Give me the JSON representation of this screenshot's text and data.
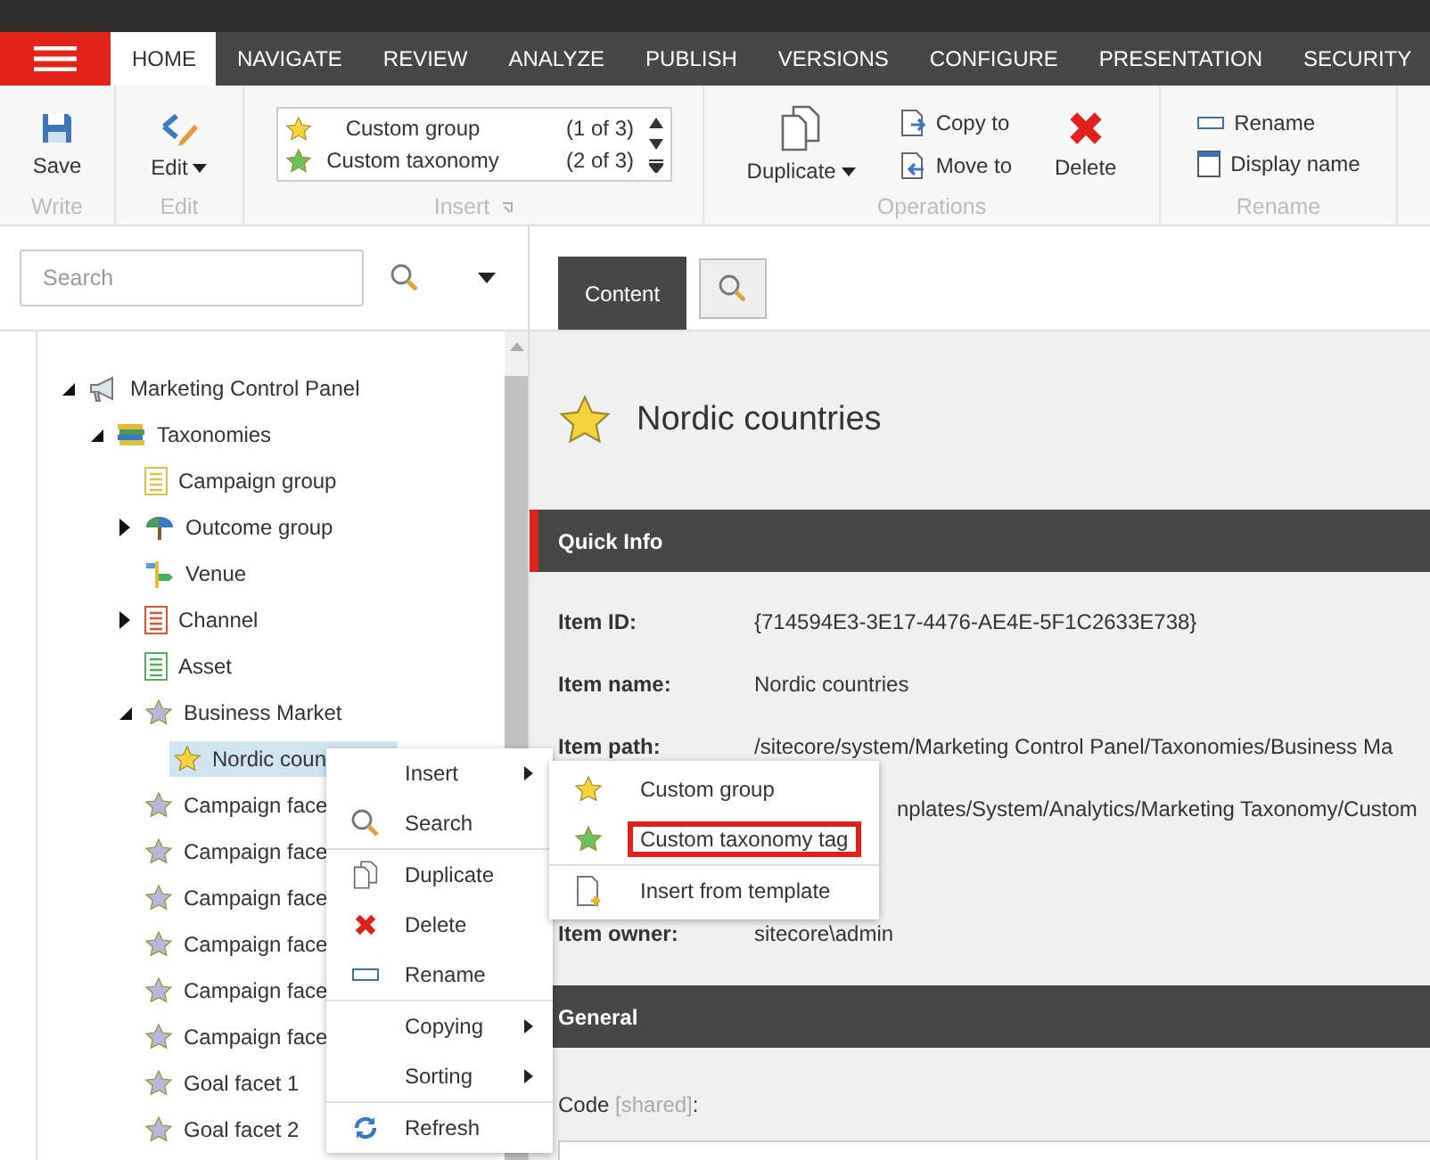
{
  "ribbon": {
    "tabs": [
      {
        "label": "HOME",
        "selected": true
      },
      {
        "label": "NAVIGATE",
        "selected": false
      },
      {
        "label": "REVIEW",
        "selected": false
      },
      {
        "label": "ANALYZE",
        "selected": false
      },
      {
        "label": "PUBLISH",
        "selected": false
      },
      {
        "label": "VERSIONS",
        "selected": false
      },
      {
        "label": "CONFIGURE",
        "selected": false
      },
      {
        "label": "PRESENTATION",
        "selected": false
      },
      {
        "label": "SECURITY",
        "selected": false
      }
    ],
    "write": {
      "label": "Write",
      "save": "Save"
    },
    "edit": {
      "label": "Edit",
      "button": "Edit"
    },
    "insert": {
      "label": "Insert",
      "items": [
        {
          "label": "Custom group",
          "count": "(1 of 3)"
        },
        {
          "label": "Custom taxonomy",
          "count": "(2 of 3)"
        }
      ]
    },
    "operations": {
      "label": "Operations",
      "duplicate": "Duplicate",
      "copy_to": "Copy to",
      "move_to": "Move to",
      "delete": "Delete"
    },
    "rename": {
      "label": "Rename",
      "rename": "Rename",
      "display_name": "Display name"
    }
  },
  "search": {
    "placeholder": "Search"
  },
  "tree": {
    "items": [
      {
        "label": "Marketing Control Panel",
        "kind": "root",
        "expanded": true,
        "selected": false,
        "children": [
          {
            "label": "Taxonomies",
            "kind": "books",
            "expanded": true,
            "selected": false,
            "children": [
              {
                "label": "Campaign group",
                "kind": "list",
                "color": "#d9c24a",
                "selected": false
              },
              {
                "label": "Outcome group",
                "kind": "umbrella",
                "expanded": false,
                "selected": false
              },
              {
                "label": "Venue",
                "kind": "sign",
                "selected": false
              },
              {
                "label": "Channel",
                "kind": "list",
                "color": "#d2553a",
                "expanded": false,
                "selected": false
              },
              {
                "label": "Asset",
                "kind": "list",
                "color": "#5aa85a",
                "selected": false
              },
              {
                "label": "Business Market",
                "kind": "star",
                "expanded": true,
                "selected": false,
                "children": [
                  {
                    "label": "Nordic coun",
                    "kind": "star",
                    "selected": true
                  }
                ]
              },
              {
                "label": "Campaign face",
                "kind": "star",
                "selected": false
              },
              {
                "label": "Campaign face",
                "kind": "star",
                "selected": false
              },
              {
                "label": "Campaign face",
                "kind": "star",
                "selected": false
              },
              {
                "label": "Campaign face",
                "kind": "star",
                "selected": false
              },
              {
                "label": "Campaign face",
                "kind": "star",
                "selected": false
              },
              {
                "label": "Campaign face",
                "kind": "star",
                "selected": false
              },
              {
                "label": "Goal facet 1",
                "kind": "star",
                "selected": false
              },
              {
                "label": "Goal facet 2",
                "kind": "star",
                "selected": false
              }
            ]
          }
        ]
      }
    ]
  },
  "context_menu": {
    "groups": [
      [
        {
          "label": "Insert",
          "has_submenu": true
        },
        {
          "label": "Search",
          "has_submenu": false
        }
      ],
      [
        {
          "label": "Duplicate",
          "has_submenu": false
        },
        {
          "label": "Delete",
          "has_submenu": false
        },
        {
          "label": "Rename",
          "has_submenu": false
        }
      ],
      [
        {
          "label": "Copying",
          "has_submenu": true
        },
        {
          "label": "Sorting",
          "has_submenu": true
        }
      ],
      [
        {
          "label": "Refresh",
          "has_submenu": false
        }
      ]
    ]
  },
  "submenu": {
    "groups": [
      [
        {
          "label": "Custom group",
          "highlighted": false
        },
        {
          "label": "Custom taxonomy tag",
          "highlighted": true
        }
      ],
      [
        {
          "label": "Insert from template",
          "highlighted": false
        }
      ]
    ]
  },
  "content": {
    "tabs": [
      {
        "label": "Content",
        "selected": true
      }
    ],
    "title": "Nordic countries",
    "sections": [
      {
        "title": "Quick Info",
        "marked": true,
        "fields": [
          {
            "label": "Item ID:",
            "value": "{714594E3-3E17-4476-AE4E-5F1C2633E738}"
          },
          {
            "label": "Item name:",
            "value": "Nordic countries"
          },
          {
            "label": "Item path:",
            "value": "/sitecore/system/Marketing Control Panel/Taxonomies/Business Ma"
          },
          {
            "value": "nplates/System/Analytics/Marketing Taxonomy/Custom"
          },
          {
            "label": "Item owner:",
            "value": "sitecore\\admin"
          }
        ]
      },
      {
        "title": "General",
        "fields": [
          {
            "label": "Code",
            "note": "[shared]",
            "suffix": ":",
            "kind": "input"
          }
        ]
      }
    ]
  }
}
